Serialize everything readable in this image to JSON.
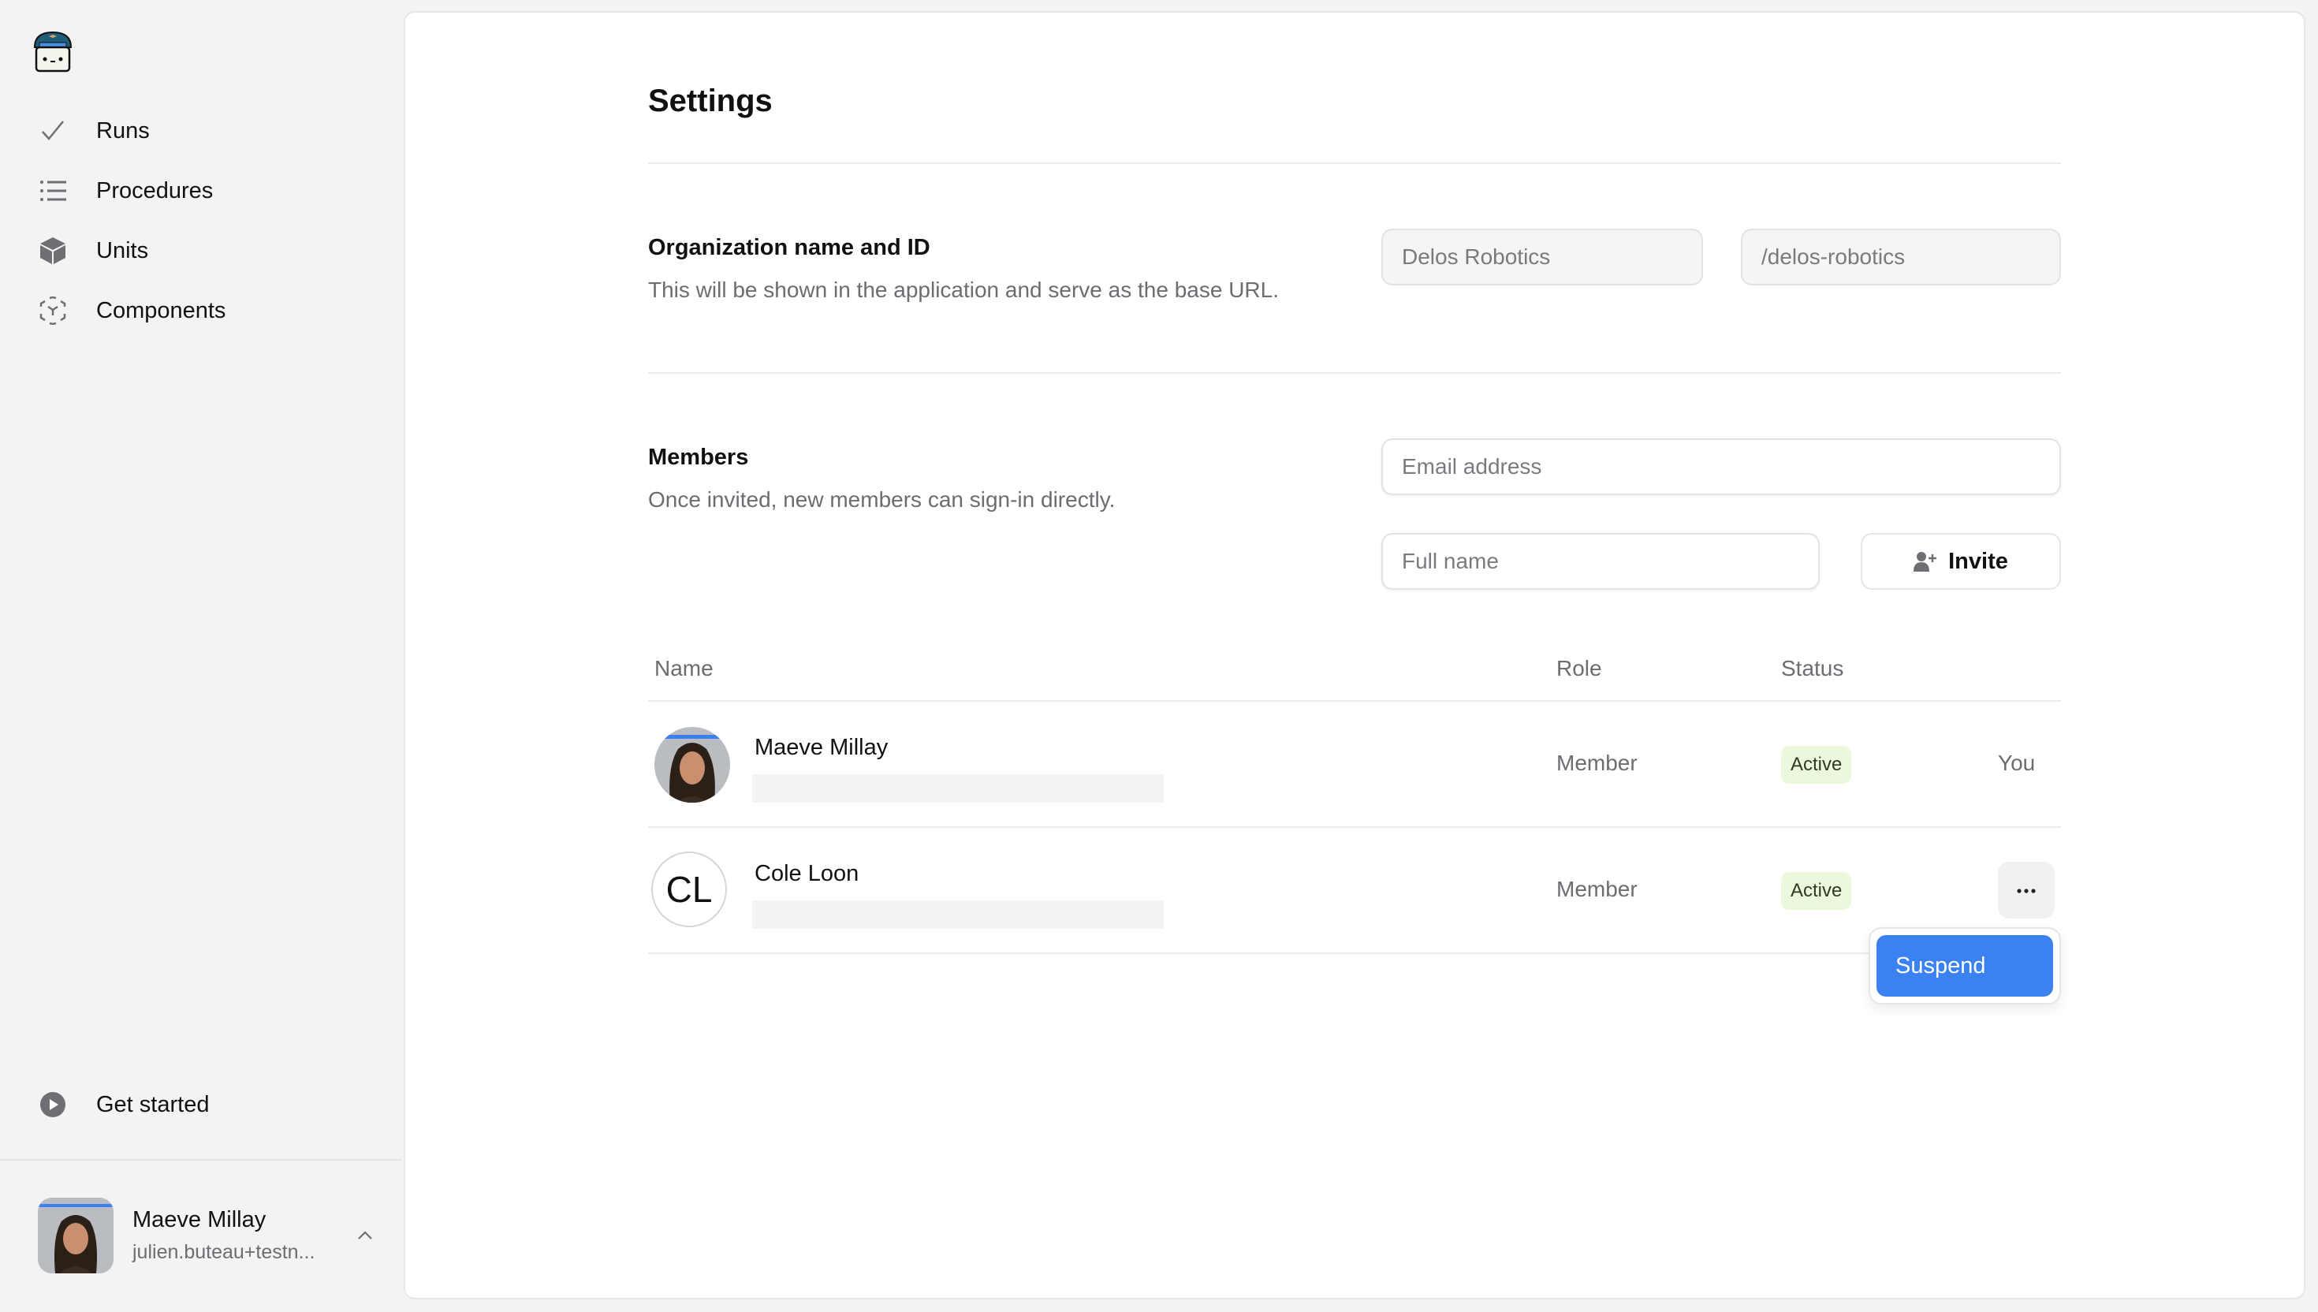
{
  "sidebar": {
    "logo": "pilot-mascot-logo",
    "nav": [
      {
        "label": "Runs",
        "icon": "check-icon"
      },
      {
        "label": "Procedures",
        "icon": "list-icon"
      },
      {
        "label": "Units",
        "icon": "cube-icon"
      },
      {
        "label": "Components",
        "icon": "component-icon"
      }
    ],
    "get_started": {
      "label": "Get started",
      "icon": "play-circle-icon"
    },
    "user": {
      "name": "Maeve Millay",
      "email": "julien.buteau+testn...",
      "icon": "chevron-up-icon"
    }
  },
  "page": {
    "title": "Settings"
  },
  "organization": {
    "title": "Organization name and ID",
    "description": "This will be shown in the application and serve as the base URL.",
    "name_value": "Delos Robotics",
    "id_value": "/delos-robotics"
  },
  "members": {
    "title": "Members",
    "description": "Once invited, new members can sign-in directly.",
    "email_placeholder": "Email address",
    "fullname_placeholder": "Full name",
    "invite_label": "Invite",
    "columns": {
      "name": "Name",
      "role": "Role",
      "status": "Status"
    },
    "rows": [
      {
        "name": "Maeve Millay",
        "avatar": "photo",
        "role": "Member",
        "status": "Active",
        "action": "You"
      },
      {
        "name": "Cole Loon",
        "initials": "CL",
        "role": "Member",
        "status": "Active",
        "action": "more"
      }
    ],
    "menu": {
      "items": [
        "Suspend"
      ],
      "highlight_color": "#3b82f0"
    }
  },
  "colors": {
    "accent": "#3b82f0",
    "badge_bg": "#ecf8dc",
    "sidebar_bg": "#f3f3f3"
  }
}
